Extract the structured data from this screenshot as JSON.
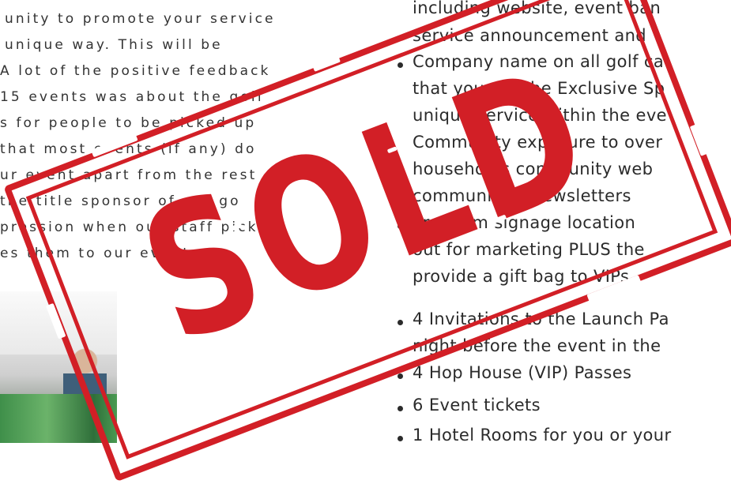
{
  "left": {
    "paragraph_lines": [
      "unity to promote your service",
      "unique way. This will be",
      "A lot of the positive feedback",
      "15 events was about the golf",
      "s for people to be picked up",
      "that most events (if any) do",
      "ur event apart from the rest",
      "the title sponsor of our go",
      "pression when our staff pick",
      "es them to our event."
    ]
  },
  "right": {
    "lines": [
      {
        "text": "including website, event ban",
        "bullet": false
      },
      {
        "text": "service announcement and",
        "bullet": false
      },
      {
        "text": "Company name on all golf ca",
        "bullet": true
      },
      {
        "text": "that you are the Exclusive Sp",
        "bullet": false
      },
      {
        "text": "unique service within the eve",
        "bullet": false
      },
      {
        "text": "Community exposure to over",
        "bullet": false
      },
      {
        "text": "households community web",
        "bullet": false
      },
      {
        "text": "community e-newsletters",
        "bullet": false
      },
      {
        "text": "Premium signage location",
        "bullet": true
      },
      {
        "text": "out for marketing PLUS the",
        "bullet": false
      },
      {
        "text": "provide a gift bag to VIPs",
        "bullet": false
      },
      {
        "text": "4 Invitations to the Launch Pa",
        "bullet": true
      },
      {
        "text": "night before the event in the",
        "bullet": false
      },
      {
        "text": "4 Hop House (VIP) Passes",
        "bullet": true
      },
      {
        "text": "6 Event tickets",
        "bullet": true
      },
      {
        "text": "1 Hotel Rooms for you or your",
        "bullet": true
      }
    ]
  },
  "stamp": {
    "text": "SOLD",
    "color": "#d21f26"
  }
}
